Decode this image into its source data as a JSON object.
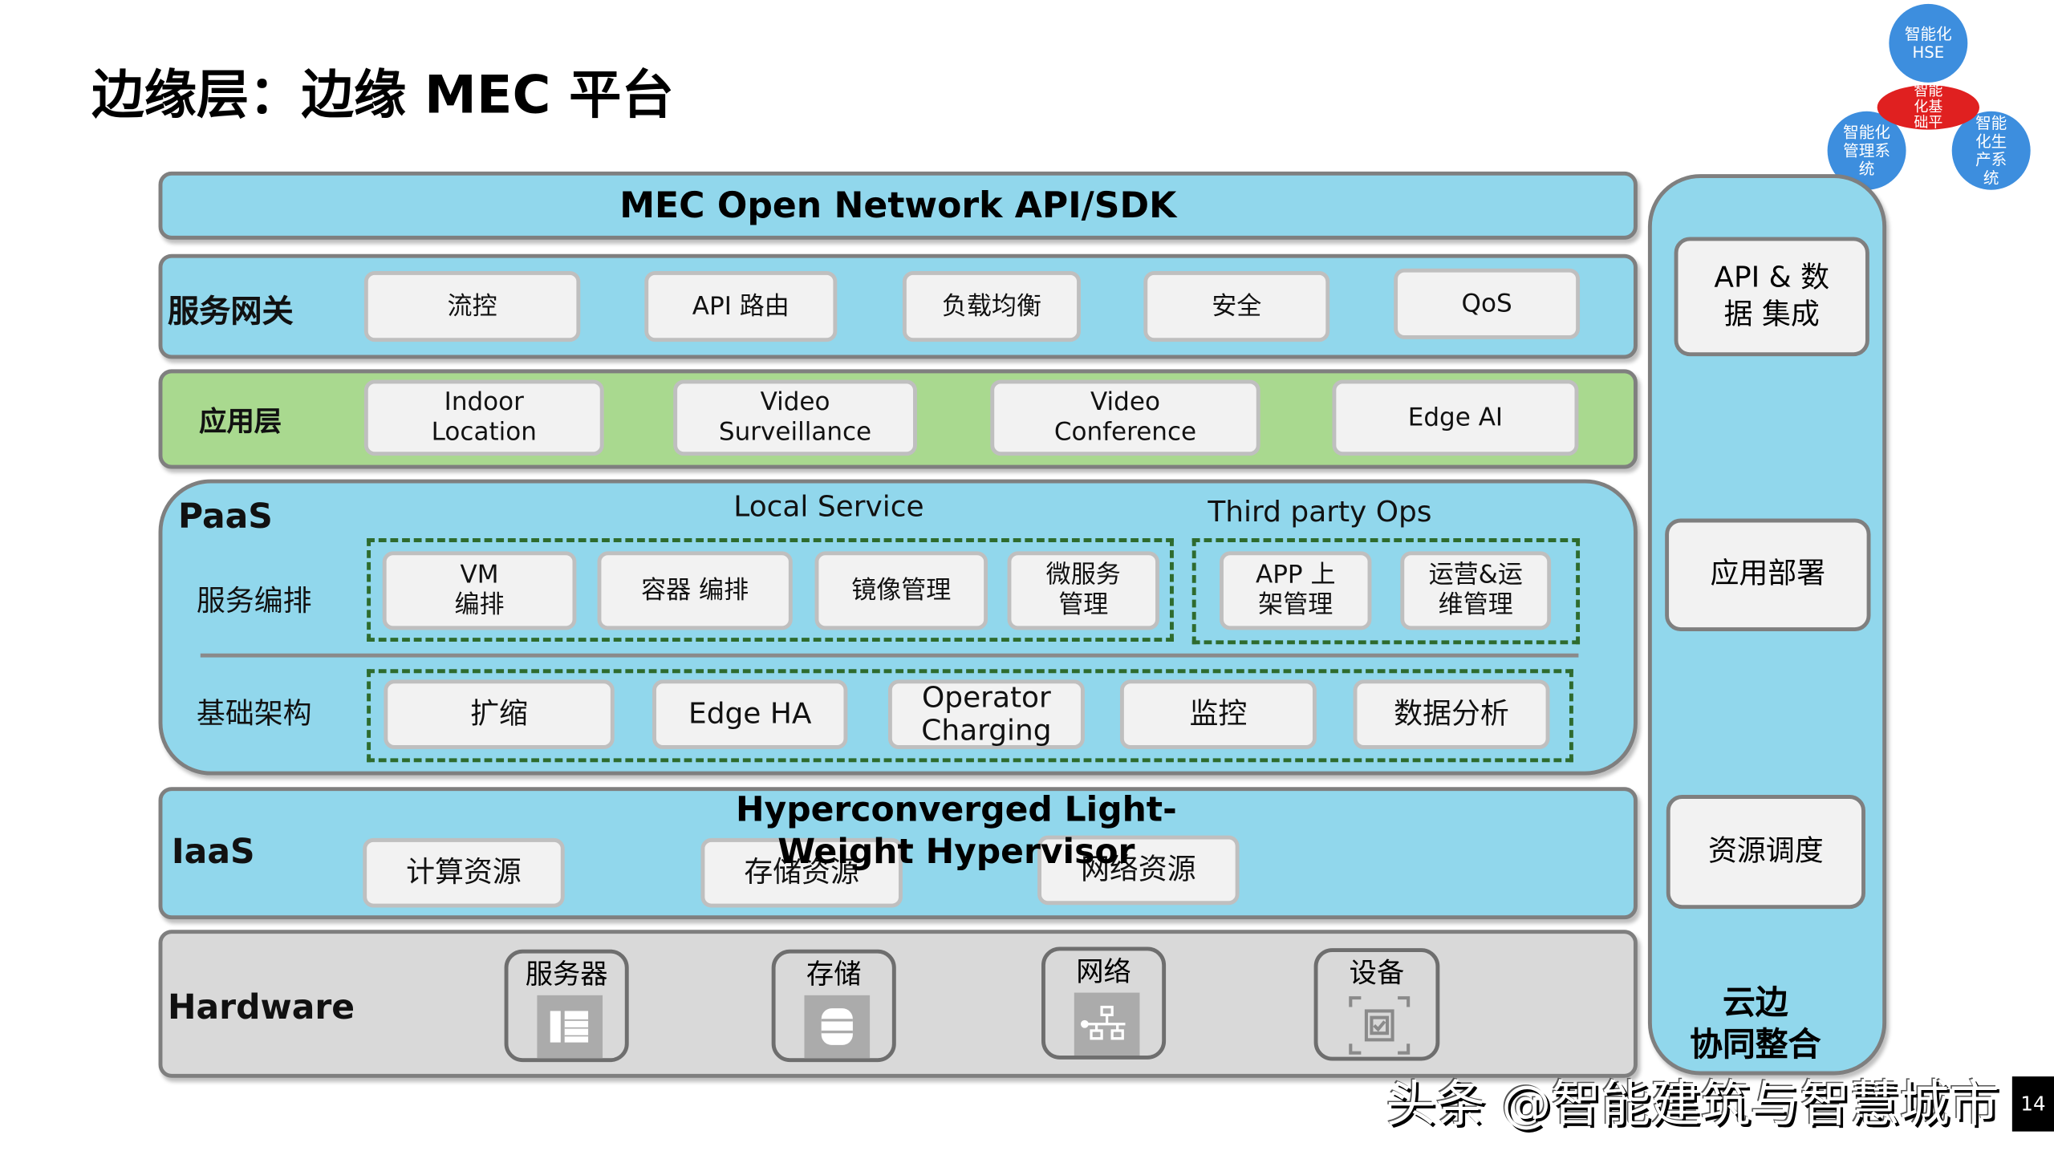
{
  "title": "边缘层：边缘 MEC 平台",
  "api_bar": "MEC Open Network API/SDK",
  "gateway": {
    "label": "服务网关",
    "items": [
      "流控",
      "API 路由",
      "负载均衡",
      "安全",
      "QoS"
    ]
  },
  "app_layer": {
    "label": "应用层",
    "items": [
      "Indoor\nLocation",
      "Video\nSurveillance",
      "Video\nConference",
      "Edge AI"
    ]
  },
  "paas": {
    "label": "PaaS",
    "local_service": "Local Service",
    "third_party": "Third party Ops",
    "orchestration": {
      "label": "服务编排",
      "local_items": [
        "VM\n编排",
        "容器 编排",
        "镜像管理",
        "微服务\n管理"
      ],
      "third_items": [
        "APP 上\n架管理",
        "运营&运\n维管理"
      ]
    },
    "infra": {
      "label": "基础架构",
      "items": [
        "扩缩",
        "Edge HA",
        "Operator\nCharging",
        "监控",
        "数据分析"
      ]
    }
  },
  "iaas": {
    "label": "IaaS",
    "title": "Hyperconverged Light-Weight Hypervisor",
    "items": [
      "计算资源",
      "存储资源",
      "网络资源"
    ]
  },
  "hardware": {
    "label": "Hardware",
    "items": [
      {
        "label": "服务器",
        "icon": "server-icon"
      },
      {
        "label": "存储",
        "icon": "database-icon"
      },
      {
        "label": "网络",
        "icon": "network-icon"
      },
      {
        "label": "设备",
        "icon": "chip-icon"
      }
    ]
  },
  "right": {
    "items": [
      "API & 数\n据 集成",
      "应用部署",
      "资源调度"
    ],
    "caption": "云边\n协同整合"
  },
  "cluster": {
    "top": "智能化\nHSE",
    "left": "智能化\n管理系\n统",
    "right": "智能\n化生\n产系\n统",
    "center": "智能\n化基\n础平"
  },
  "watermark": "头条 @智能建筑与智慧城市",
  "page_number": "14",
  "colors": {
    "layer_blue": "#91d7ec",
    "app_green": "#a9d98f",
    "hardware_gray": "#d9d9d9",
    "circle_blue": "#3d8ede",
    "center_red": "#e02020"
  }
}
